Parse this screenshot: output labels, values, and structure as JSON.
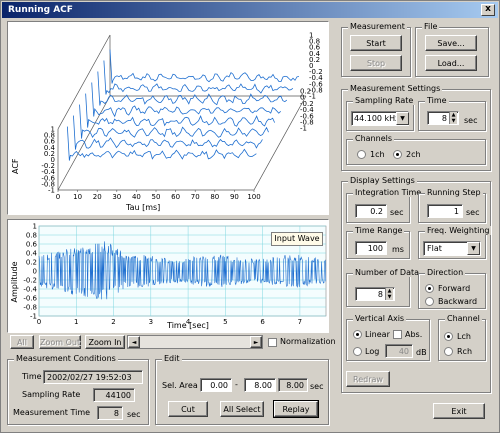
{
  "window": {
    "title": "Running ACF",
    "close_glyph": "x"
  },
  "acf_plot": {
    "ylabel": "ACF",
    "xlabel": "Tau [ms]",
    "x_ticks": [
      "0",
      "10",
      "20",
      "30",
      "40",
      "50",
      "60",
      "70",
      "80",
      "90",
      "100"
    ],
    "y_ticks_front": [
      "1",
      "0.8",
      "0.6",
      "0.4",
      "0.2",
      "0",
      "-0.2",
      "-0.4",
      "-0.6",
      "-0.8",
      "-1"
    ],
    "y_ticks_back": [
      "1",
      "0.8",
      "0.6",
      "0.4",
      "0.2",
      "0",
      "-0.2",
      "-0.4",
      "-0.6",
      "-0.8",
      "-1"
    ],
    "y_ticks_right_low": [
      "0.2",
      "0",
      "-0.2",
      "-0.4",
      "-0.6",
      "-0.8",
      "-1"
    ],
    "line_color": "#1f6fd0"
  },
  "wave_plot": {
    "ylabel": "Amplitude",
    "xlabel": "Time [sec]",
    "y_ticks": [
      "1",
      "0.8",
      "0.6",
      "0.4",
      "0.2",
      "0",
      "-0.2",
      "-0.4",
      "-0.6",
      "-0.8",
      "-1"
    ],
    "x_ticks": [
      "0",
      "1",
      "2",
      "3",
      "4",
      "5",
      "6",
      "7"
    ],
    "overlay_label": "Input Wave",
    "wave_color": "#1f6fd0",
    "grid_color": "#7fd6e0"
  },
  "zoom_bar": {
    "all": "All",
    "zoom_out": "Zoom Out",
    "zoom_in": "Zoom In",
    "left_arrow": "◄",
    "right_arrow": "►",
    "normalization": "Normalization"
  },
  "conditions": {
    "legend": "Measurement Conditions",
    "time_label": "Time",
    "time_value": "2002/02/27 19:52:03",
    "sampling_label": "Sampling Rate",
    "sampling_value": "44100",
    "mtime_label": "Measurement Time",
    "mtime_value": "8",
    "mtime_unit": "sec"
  },
  "edit": {
    "legend": "Edit",
    "sel_label": "Sel. Area",
    "sel_from": "0.00",
    "dash": "-",
    "sel_to": "8.00",
    "sel_len": "8.00",
    "unit": "sec",
    "cut": "Cut",
    "all_select": "All Select",
    "replay": "Replay"
  },
  "measurement": {
    "legend": "Measurement",
    "start": "Start",
    "stop": "Stop"
  },
  "file": {
    "legend": "File",
    "save": "Save...",
    "load": "Load..."
  },
  "meas_settings": {
    "legend": "Measurement Settings",
    "sampling_legend": "Sampling Rate",
    "sampling_value": "44.100 kHz",
    "time_legend": "Time",
    "time_value": "8",
    "time_unit": "sec",
    "channels_legend": "Channels",
    "ch1": "1ch",
    "ch2": "2ch"
  },
  "display": {
    "legend": "Display Settings",
    "integration_legend": "Integration Time",
    "integration_value": "0.2",
    "integration_unit": "sec",
    "running_legend": "Running Step",
    "running_value": "1",
    "running_unit": "sec",
    "range_legend": "Time Range",
    "range_value": "100",
    "range_unit": "ms",
    "freq_legend": "Freq. Weighting",
    "freq_value": "Flat",
    "data_legend": "Number of Data",
    "data_value": "8",
    "direction_legend": "Direction",
    "forward": "Forward",
    "backward": "Backward",
    "vaxis_legend": "Vertical Axis",
    "linear": "Linear",
    "abs": "Abs.",
    "log": "Log",
    "log_value": "40",
    "log_unit": "dB",
    "channel_legend": "Channel",
    "lch": "Lch",
    "rch": "Rch",
    "redraw": "Redraw"
  },
  "exit": "Exit"
}
